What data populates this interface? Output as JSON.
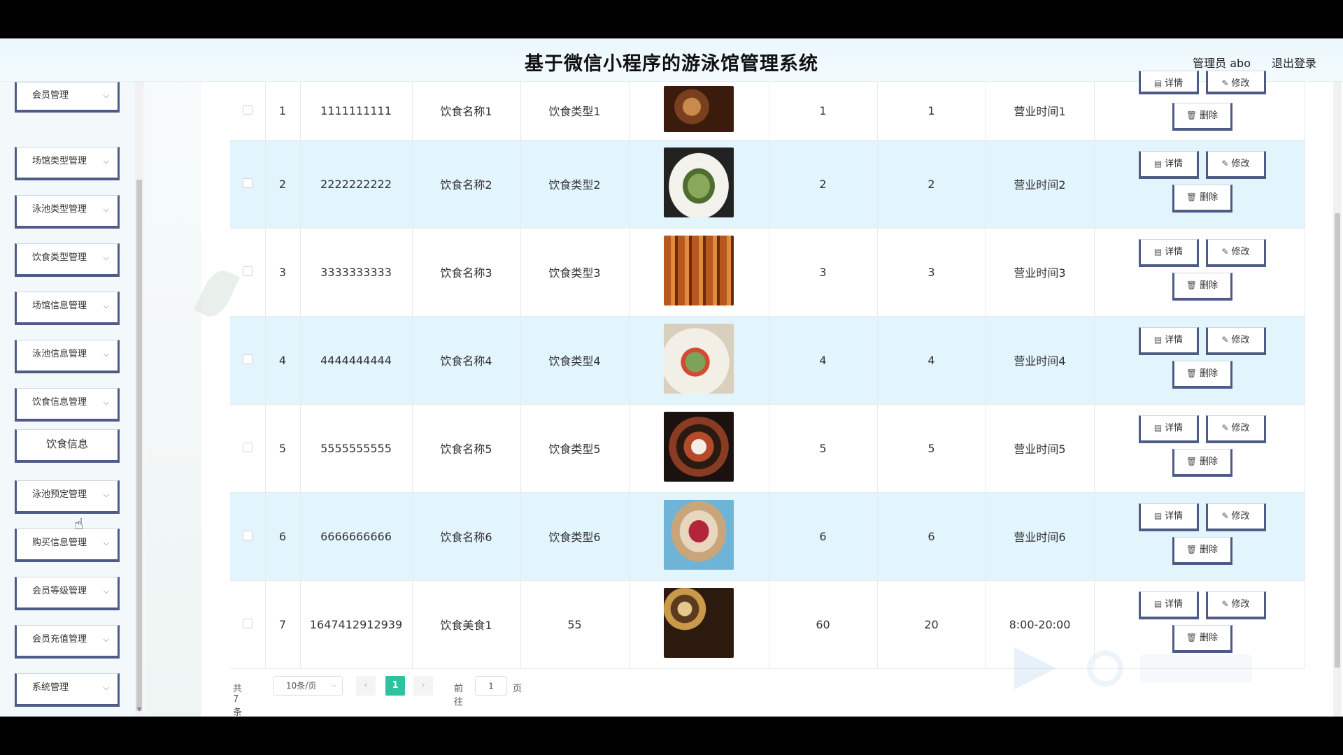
{
  "header": {
    "title": "基于微信小程序的游泳馆管理系统",
    "user": "管理员 abo",
    "logout": "退出登录"
  },
  "sidebar": {
    "items": [
      {
        "label": "会员管理"
      },
      {
        "label": "场馆类型管理"
      },
      {
        "label": "泳池类型管理"
      },
      {
        "label": "饮食类型管理"
      },
      {
        "label": "场馆信息管理"
      },
      {
        "label": "泳池信息管理"
      },
      {
        "label": "饮食信息管理"
      },
      {
        "label": "饮食信息",
        "sub": true
      },
      {
        "label": "泳池预定管理"
      },
      {
        "label": "购买信息管理"
      },
      {
        "label": "会员等级管理"
      },
      {
        "label": "会员充值管理"
      },
      {
        "label": "系统管理"
      }
    ]
  },
  "table": {
    "buttons": {
      "detail": "详情",
      "edit": "修改",
      "delete": "删除"
    },
    "rows": [
      {
        "index": "1",
        "code": "1111111111",
        "name": "饮食名称1",
        "type": "饮食类型1",
        "c5": "1",
        "c6": "1",
        "hours": "营业时间1",
        "image": "food-image-1"
      },
      {
        "index": "2",
        "code": "2222222222",
        "name": "饮食名称2",
        "type": "饮食类型2",
        "c5": "2",
        "c6": "2",
        "hours": "营业时间2",
        "image": "food-image-2"
      },
      {
        "index": "3",
        "code": "3333333333",
        "name": "饮食名称3",
        "type": "饮食类型3",
        "c5": "3",
        "c6": "3",
        "hours": "营业时间3",
        "image": "food-image-3"
      },
      {
        "index": "4",
        "code": "4444444444",
        "name": "饮食名称4",
        "type": "饮食类型4",
        "c5": "4",
        "c6": "4",
        "hours": "营业时间4",
        "image": "food-image-4"
      },
      {
        "index": "5",
        "code": "5555555555",
        "name": "饮食名称5",
        "type": "饮食类型5",
        "c5": "5",
        "c6": "5",
        "hours": "营业时间5",
        "image": "food-image-5"
      },
      {
        "index": "6",
        "code": "6666666666",
        "name": "饮食名称6",
        "type": "饮食类型6",
        "c5": "6",
        "c6": "6",
        "hours": "营业时间6",
        "image": "food-image-6"
      },
      {
        "index": "7",
        "code": "1647412912939",
        "name": "饮食美食1",
        "type": "55",
        "c5": "60",
        "c6": "20",
        "hours": "8:00-20:00",
        "image": "food-image-7"
      }
    ]
  },
  "pager": {
    "total": "共 7 条",
    "page_size": "10条/页",
    "current": "1",
    "goto_label": "前往",
    "goto_value": "1",
    "goto_suffix": "页"
  },
  "colors": {
    "accent": "#2dc3a0",
    "row_alt": "#e2f4fc",
    "button_border": "#4e5b86"
  }
}
